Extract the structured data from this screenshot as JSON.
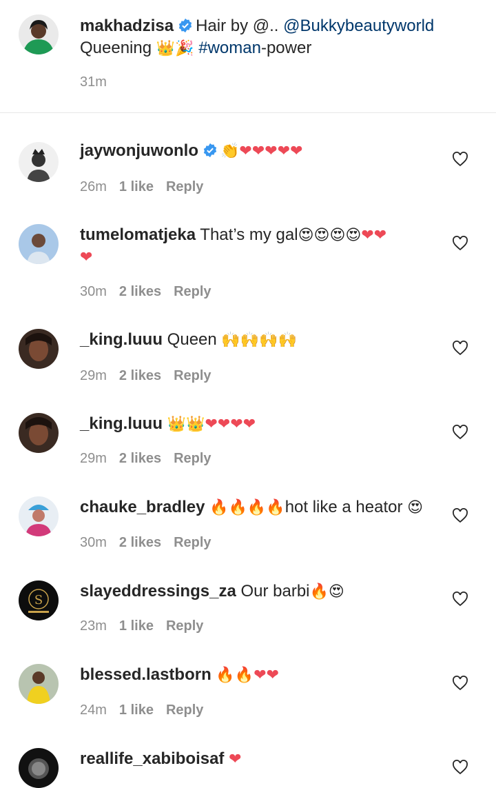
{
  "caption": {
    "username": "makhadzisa",
    "text_prefix": "Hair by @..",
    "mention": "@Bukkybeautyworld",
    "line2_prefix": "Queening ",
    "line2_emoji": "👑🎉",
    "hashtag": "#woman",
    "line2_suffix": "-power",
    "time": "31m"
  },
  "comments": [
    {
      "username": "jaywonjuwonlo",
      "verified": true,
      "text": "",
      "emoji": "👏❤❤❤❤❤",
      "time": "26m",
      "likes": "1 like",
      "reply": "Reply"
    },
    {
      "username": "tumelomatjeka",
      "verified": false,
      "text": "That’s my gal",
      "emoji": "😍😍😍😍❤❤",
      "emoji_line2": "❤",
      "time": "30m",
      "likes": "2 likes",
      "reply": "Reply"
    },
    {
      "username": "_king.luuu",
      "verified": false,
      "text": "Queen",
      "emoji": "🙌🙌🙌🙌",
      "time": "29m",
      "likes": "2 likes",
      "reply": "Reply"
    },
    {
      "username": "_king.luuu",
      "verified": false,
      "text": "",
      "emoji": "👑👑❤❤❤❤",
      "time": "29m",
      "likes": "2 likes",
      "reply": "Reply"
    },
    {
      "username": "chauke_bradley",
      "verified": false,
      "text": "",
      "emoji": "🔥🔥🔥🔥",
      "text_after": "hot like a heator",
      "emoji_after": "😍",
      "time": "30m",
      "likes": "2 likes",
      "reply": "Reply"
    },
    {
      "username": "slayeddressings_za",
      "verified": false,
      "text": "Our barbi",
      "emoji": "🔥😍",
      "time": "23m",
      "likes": "1 like",
      "reply": "Reply"
    },
    {
      "username": "blessed.lastborn",
      "verified": false,
      "text": "",
      "emoji": "🔥🔥❤❤",
      "time": "24m",
      "likes": "1 like",
      "reply": "Reply"
    },
    {
      "username": "reallife_xabiboisaf",
      "verified": false,
      "text": "",
      "emoji": "❤",
      "time": "",
      "likes": "",
      "reply": ""
    }
  ],
  "colors": {
    "heart_red": "#ed4956",
    "link": "#00376b",
    "verified": "#3897f0",
    "meta": "#8e8e8e"
  }
}
